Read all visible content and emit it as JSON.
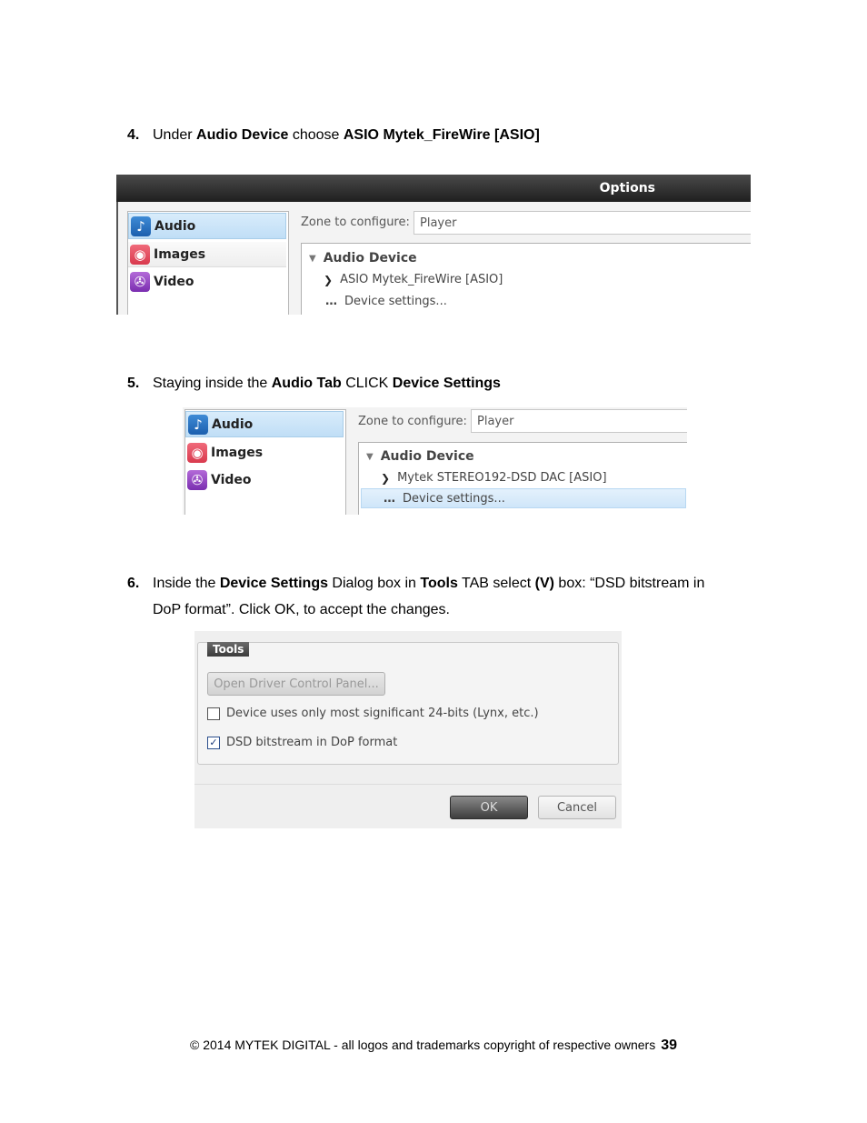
{
  "steps": [
    {
      "number": "4.",
      "parts": [
        {
          "t": "Under ",
          "b": false
        },
        {
          "t": "Audio Device",
          "b": true
        },
        {
          "t": " choose ",
          "b": false
        },
        {
          "t": "ASIO Mytek_FireWire [ASIO]",
          "b": true
        }
      ]
    },
    {
      "number": "5.",
      "parts": [
        {
          "t": "Staying inside the ",
          "b": false
        },
        {
          "t": "Audio Tab",
          "b": true
        },
        {
          "t": " CLICK ",
          "b": false
        },
        {
          "t": "Device Settings",
          "b": true
        }
      ]
    },
    {
      "number": "6.",
      "parts": [
        {
          "t": "Inside the ",
          "b": false
        },
        {
          "t": "Device Settings",
          "b": true
        },
        {
          "t": " Dialog box in ",
          "b": false
        },
        {
          "t": "Tools",
          "b": true
        },
        {
          "t": " TAB select ",
          "b": false
        },
        {
          "t": "(V)",
          "b": true
        },
        {
          "t": " box: “DSD bitstream in",
          "b": false
        }
      ],
      "line2": "DoP format”. Click OK, to accept the changes."
    }
  ],
  "shot1": {
    "window_title": "Options",
    "sidebar": [
      {
        "label": "Audio",
        "icon": "music-note-icon"
      },
      {
        "label": "Images",
        "icon": "camera-icon"
      },
      {
        "label": "Video",
        "icon": "film-camera-icon"
      }
    ],
    "zone_label": "Zone to configure:",
    "zone_value": "Player",
    "section_title": "Audio Device",
    "device": "ASIO Mytek_FireWire [ASIO]",
    "settings_link": "Device settings..."
  },
  "shot2": {
    "sidebar": [
      {
        "label": "Audio",
        "icon": "music-note-icon"
      },
      {
        "label": "Images",
        "icon": "camera-icon"
      },
      {
        "label": "Video",
        "icon": "film-camera-icon"
      }
    ],
    "zone_label": "Zone to configure:",
    "zone_value": "Player",
    "section_title": "Audio Device",
    "device": "Mytek STEREO192-DSD DAC [ASIO]",
    "settings_link": "Device settings..."
  },
  "shot3": {
    "tab": "Tools",
    "driver_button": "Open Driver Control Panel...",
    "options": [
      {
        "label": "Device uses only most significant 24-bits (Lynx, etc.)",
        "checked": false
      },
      {
        "label": "DSD bitstream in DoP format",
        "checked": true
      }
    ],
    "ok": "OK",
    "cancel": "Cancel"
  },
  "footer": {
    "text": "© 2014 MYTEK DIGITAL - all logos and trademarks copyright of respective owners",
    "page": "39"
  }
}
